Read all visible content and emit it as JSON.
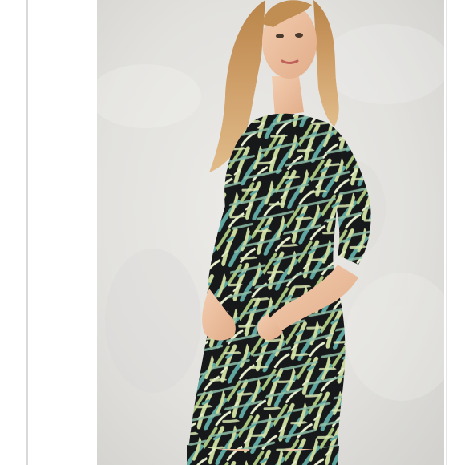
{
  "photo": {
    "subject": "woman-in-tropical-print-bodycon-dress",
    "background_color": "#e4e4e2",
    "dress_colors": {
      "base": "#17181a",
      "leaf_light": "#c9d89c",
      "leaf_mid": "#a9c47e",
      "leaf_teal": "#5fa7a0",
      "leaf_pale": "#e7efcf"
    },
    "hair_color": "#c9955b",
    "skin_color": "#efc4a2"
  }
}
